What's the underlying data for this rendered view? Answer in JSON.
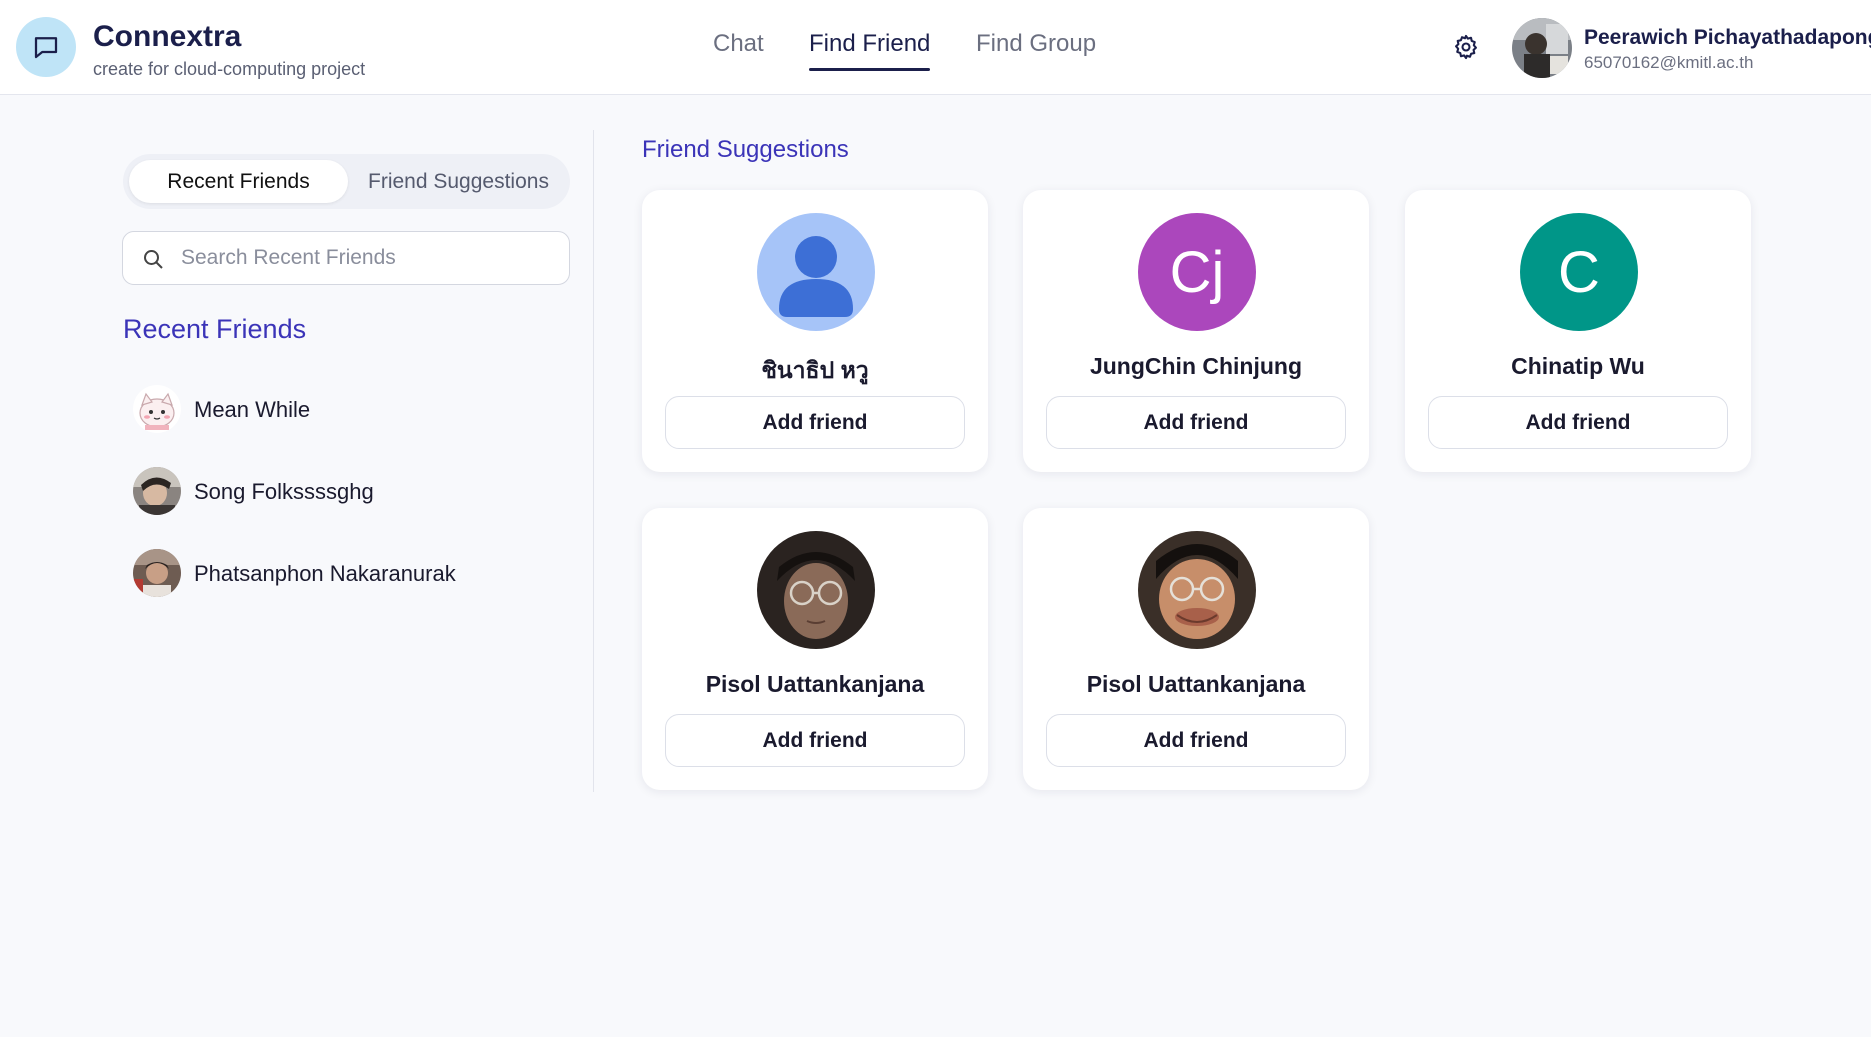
{
  "app": {
    "title": "Connextra",
    "subtitle": "create for cloud-computing project"
  },
  "nav": {
    "items": [
      {
        "label": "Chat",
        "active": false
      },
      {
        "label": "Find Friend",
        "active": true
      },
      {
        "label": "Find Group",
        "active": false
      }
    ]
  },
  "user": {
    "name": "Peerawich Pichayathadapong",
    "email": "65070162@kmitl.ac.th"
  },
  "left_panel": {
    "tabs": [
      {
        "label": "Recent Friends",
        "active": true
      },
      {
        "label": "Friend Suggestions",
        "active": false
      }
    ],
    "search_placeholder": "Search Recent Friends",
    "heading": "Recent Friends",
    "friends": [
      {
        "name": "Mean While",
        "avatar": "cartoon-cat"
      },
      {
        "name": "Song Folkssssghg",
        "avatar": "photo"
      },
      {
        "name": "Phatsanphon Nakaranurak",
        "avatar": "photo"
      }
    ]
  },
  "suggestions": {
    "heading": "Friend Suggestions",
    "button_label": "Add friend",
    "cards": [
      {
        "name": "ชินาธิป หวู",
        "avatar_type": "default-person",
        "avatar_color": "#a6c4f8",
        "initials": ""
      },
      {
        "name": "JungChin Chinjung",
        "avatar_type": "initials",
        "avatar_color": "#ab47bc",
        "initials": "Cj"
      },
      {
        "name": "Chinatip Wu",
        "avatar_type": "initials",
        "avatar_color": "#009688",
        "initials": "C"
      },
      {
        "name": "Pisol Uattankanjana",
        "avatar_type": "photo",
        "avatar_color": "#2a2320",
        "initials": ""
      },
      {
        "name": "Pisol Uattankanjana",
        "avatar_type": "photo",
        "avatar_color": "#3a2f28",
        "initials": ""
      }
    ]
  },
  "colors": {
    "accent": "#3b34b8",
    "brand_dark": "#1b1f4b",
    "logo_bg": "#bfe4f7",
    "background": "#f8f9fc"
  }
}
